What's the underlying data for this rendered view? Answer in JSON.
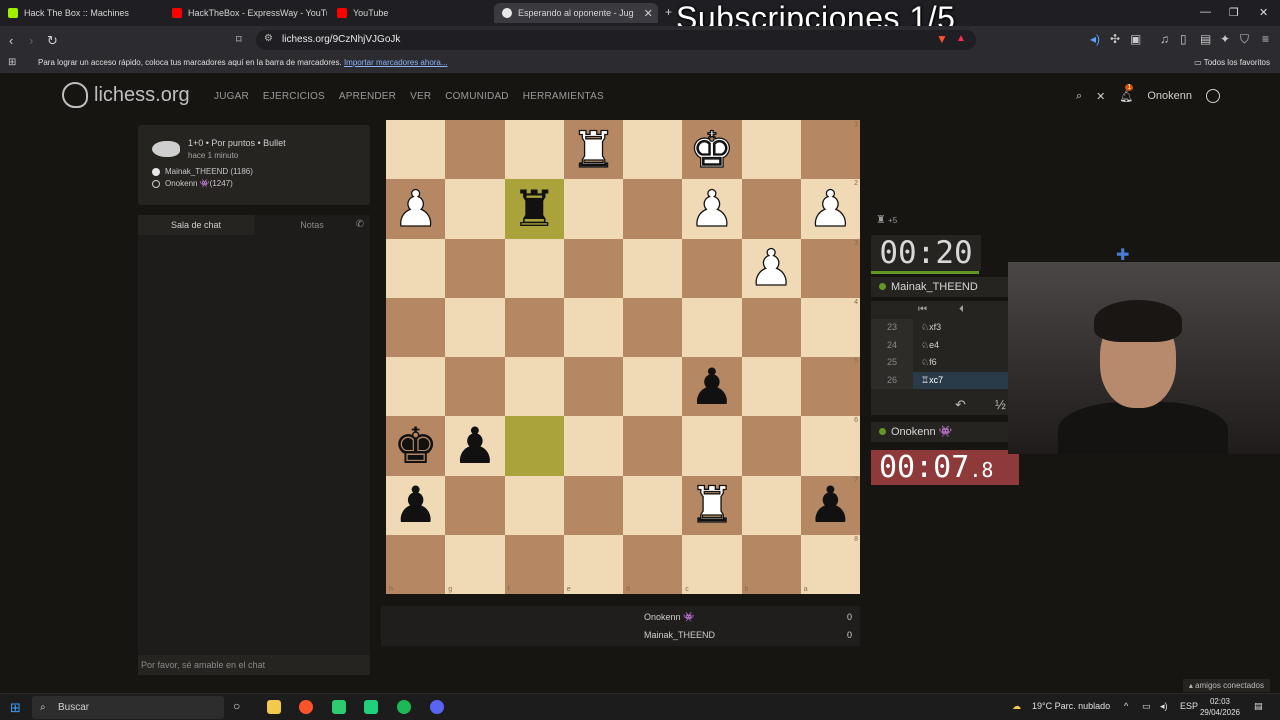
{
  "browser": {
    "tabs": [
      {
        "label": "Hack The Box :: Machines",
        "color": "#9fef00"
      },
      {
        "label": "HackTheBox - ExpressWay - YouTube",
        "color": "#ff0000"
      },
      {
        "label": "YouTube",
        "color": "#ff0000"
      },
      {
        "label": "Esperando al oponente - Jug",
        "color": "#e8e8e8"
      }
    ],
    "overlay": "Subscripciones 1/5",
    "url": "lichess.org/9CzNhjVJGoJk",
    "bookmarks_hint": "Para lograr un acceso rápido, coloca tus marcadores aquí en la barra de marcadores.",
    "bookmarks_link": "Importar marcadores ahora...",
    "bookmarks_right": "Todos los favoritos"
  },
  "header": {
    "logo": "lichess.org",
    "nav": [
      "JUGAR",
      "EJERCICIOS",
      "APRENDER",
      "VER",
      "COMUNIDAD",
      "HERRAMIENTAS"
    ],
    "username": "Onokenn",
    "notif_count": "1"
  },
  "game": {
    "title": "1+0 • Por puntos • Bullet",
    "ago": "hace 1 minuto",
    "white": "Mainak_THEEND (1186)",
    "black": "Onokenn 👾(1247)"
  },
  "chat": {
    "tab_chat": "Sala de chat",
    "tab_notes": "Notas",
    "placeholder": "Por favor, sé amable en el chat"
  },
  "board": {
    "rows": [
      [
        "",
        "",
        "",
        "wR",
        "",
        "wK",
        "",
        ""
      ],
      [
        "wP",
        "",
        "bR",
        "",
        "",
        "wP",
        "",
        "wP"
      ],
      [
        "",
        "",
        "",
        "",
        "",
        "",
        "wP",
        ""
      ],
      [
        "",
        "",
        "",
        "",
        "",
        "",
        "",
        ""
      ],
      [
        "",
        "",
        "",
        "",
        "",
        "bP",
        "",
        ""
      ],
      [
        "bK",
        "bP",
        "",
        "",
        "",
        "",
        "",
        ""
      ],
      [
        "bP",
        "",
        "",
        "",
        "",
        "wR",
        "",
        "bP"
      ],
      [
        "",
        "",
        "",
        "",
        "",
        "",
        "",
        ""
      ]
    ],
    "highlights": [
      "1-2",
      "5-2"
    ],
    "files": [
      "h",
      "g",
      "f",
      "e",
      "d",
      "c",
      "b",
      "a"
    ],
    "ranks": [
      "1",
      "2",
      "3",
      "4",
      "5",
      "6",
      "7",
      "8"
    ]
  },
  "scores": {
    "p1": {
      "name": "Onokenn 👾",
      "score": "0"
    },
    "p2": {
      "name": "Mainak_THEEND",
      "score": "0"
    }
  },
  "right": {
    "material": "+5",
    "clock_top": "00:20",
    "top_player": "Mainak_THEEND",
    "moves": [
      {
        "num": "23",
        "san": "♘xf3"
      },
      {
        "num": "24",
        "san": "♘e4"
      },
      {
        "num": "25",
        "san": "♘f6"
      },
      {
        "num": "26",
        "san": "♖xc7"
      }
    ],
    "bottom_player": "Onokenn 👾",
    "clock_bottom": "00:07",
    "clock_bottom_tenths": ".8"
  },
  "taskbar": {
    "search": "Buscar",
    "weather": "19°C  Parc. nublado",
    "lang": "ESP",
    "time": "02:03",
    "date": "29/04/2026",
    "friends": "amigos conectados"
  }
}
